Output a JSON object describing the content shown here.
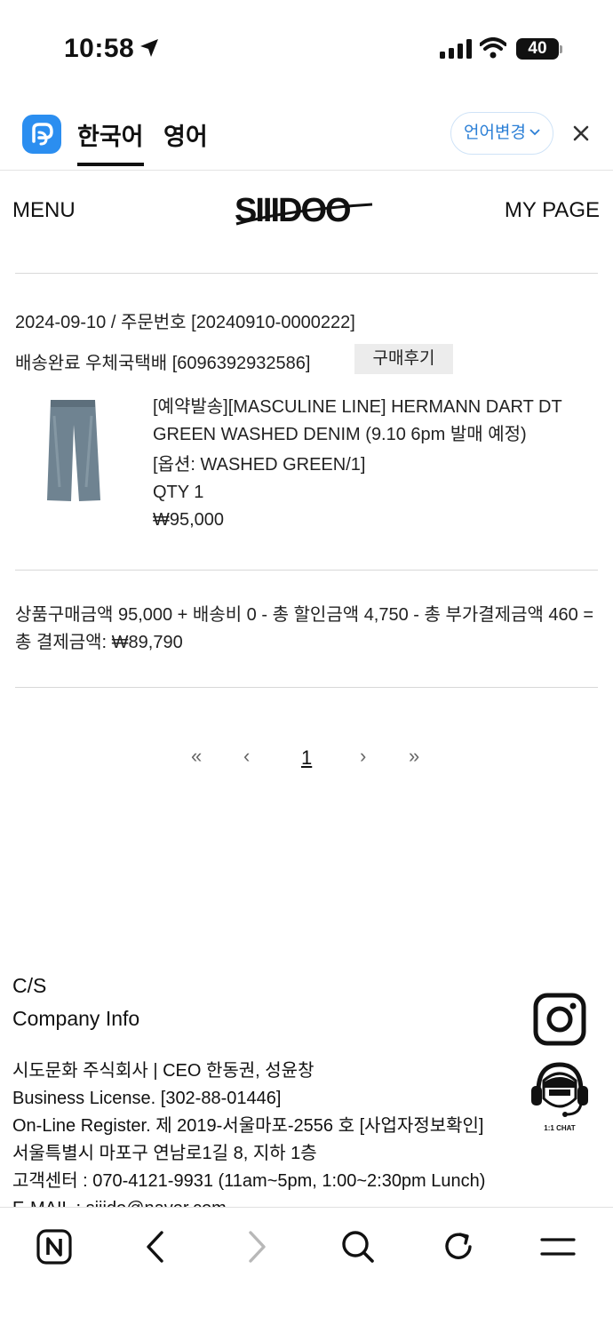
{
  "status_bar": {
    "time": "10:58",
    "battery": "40"
  },
  "translate_bar": {
    "active_lang": "한국어",
    "other_lang": "영어",
    "change_label": "언어변경"
  },
  "header": {
    "menu": "MENU",
    "logo_text": "SIIIDOO",
    "mypage": "MY PAGE"
  },
  "order": {
    "date_line": "2024-09-10 / 주문번호 [20240910-0000222]",
    "shipping_line": "배송완료 우체국택배 [6096392932586]",
    "review_button": "구매후기",
    "product": {
      "name": "[예약발송][MASCULINE LINE] HERMANN DART DT GREEN WASHED DENIM (9.10 6pm 발매 예정)",
      "option": "[옵션: WASHED GREEN/1]",
      "qty": "QTY 1",
      "price": "₩95,000"
    },
    "summary": "상품구매금액 95,000 + 배송비 0 - 총 할인금액 4,750 - 총 부가결제금액 460 = 총 결제금액: ₩89,790"
  },
  "pagination": {
    "first": "«",
    "prev": "‹",
    "current": "1",
    "next": "›",
    "last": "»"
  },
  "footer": {
    "cs": "C/S",
    "company_info": "Company Info",
    "lines": [
      "시도문화 주식회사 | CEO 한동권, 성윤창",
      "Business License. [302-88-01446]",
      "On-Line Register. 제 2019-서울마포-2556 호 [사업자정보확인]",
      "서울특별시 마포구 연남로1길 8, 지하 1층",
      "고객센터 : 070-4121-9931 (11am~5pm, 1:00~2:30pm Lunch)",
      "E-MAIL : siiido@naver.com"
    ],
    "chat_label": "1:1 CHAT"
  },
  "colors": {
    "accent_blue": "#2b8ef0",
    "divider": "#d8d8d8"
  }
}
